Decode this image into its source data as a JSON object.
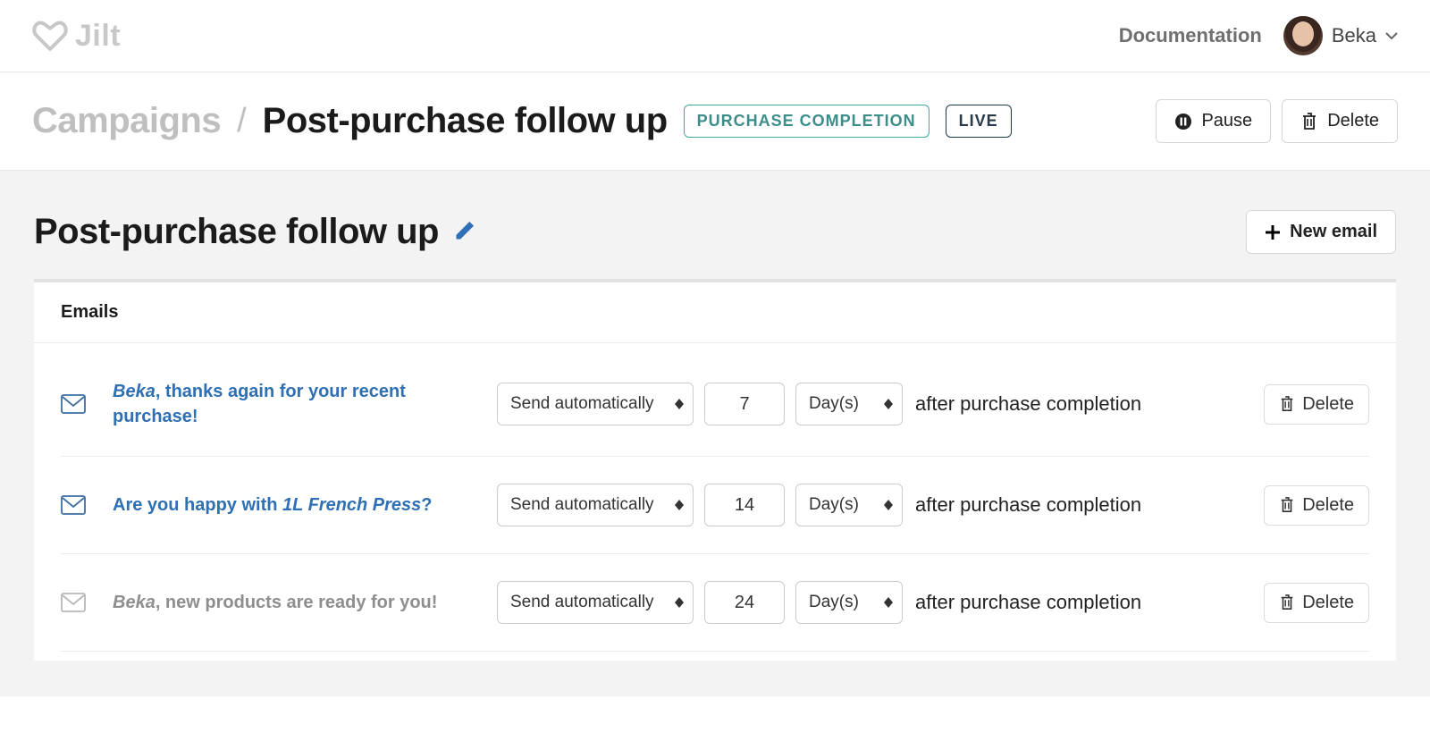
{
  "header": {
    "brand": "Jilt",
    "doc_link": "Documentation",
    "user_name": "Beka"
  },
  "breadcrumb": {
    "root": "Campaigns",
    "current": "Post-purchase follow up",
    "badges": {
      "category": "PURCHASE COMPLETION",
      "status": "LIVE"
    },
    "actions": {
      "pause": "Pause",
      "delete": "Delete"
    }
  },
  "page": {
    "title": "Post-purchase follow up",
    "new_email": "New email"
  },
  "panel": {
    "heading": "Emails",
    "after_text": "after purchase completion",
    "delete_label": "Delete",
    "rows": [
      {
        "icon_muted": false,
        "subject_prefix": "Beka",
        "subject_mid": ", thanks again for your recent purchase!",
        "mode": "Send automatically",
        "value": "7",
        "unit": "Day(s)"
      },
      {
        "icon_muted": false,
        "subject_plain_lead": "Are you happy with ",
        "subject_ital": "1L French Press",
        "subject_trail": "?",
        "mode": "Send automatically",
        "value": "14",
        "unit": "Day(s)"
      },
      {
        "icon_muted": true,
        "subject_prefix": "Beka",
        "subject_mid": ", new products are ready for you!",
        "mode": "Send automatically",
        "value": "24",
        "unit": "Day(s)"
      }
    ]
  }
}
